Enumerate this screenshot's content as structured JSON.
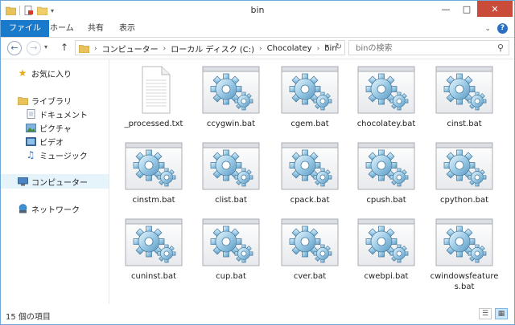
{
  "window": {
    "title": "bin"
  },
  "ribbon": {
    "tabs": [
      {
        "label": "ファイル"
      },
      {
        "label": "ホーム"
      },
      {
        "label": "共有"
      },
      {
        "label": "表示"
      }
    ]
  },
  "address": {
    "crumbs": [
      "コンピューター",
      "ローカル ディスク (C:)",
      "Chocolatey",
      "bin"
    ]
  },
  "search": {
    "placeholder": "binの検索"
  },
  "navpane": {
    "favorites": "お気に入り",
    "libraries": "ライブラリ",
    "documents": "ドキュメント",
    "pictures": "ピクチャ",
    "videos": "ビデオ",
    "music": "ミュージック",
    "computer": "コンピューター",
    "network": "ネットワーク"
  },
  "files": [
    {
      "name": "_processed.txt",
      "icon": "text-file-icon"
    },
    {
      "name": "ccygwin.bat",
      "icon": "batch-file-icon"
    },
    {
      "name": "cgem.bat",
      "icon": "batch-file-icon"
    },
    {
      "name": "chocolatey.bat",
      "icon": "batch-file-icon"
    },
    {
      "name": "cinst.bat",
      "icon": "batch-file-icon"
    },
    {
      "name": "cinstm.bat",
      "icon": "batch-file-icon"
    },
    {
      "name": "clist.bat",
      "icon": "batch-file-icon"
    },
    {
      "name": "cpack.bat",
      "icon": "batch-file-icon"
    },
    {
      "name": "cpush.bat",
      "icon": "batch-file-icon"
    },
    {
      "name": "cpython.bat",
      "icon": "batch-file-icon"
    },
    {
      "name": "cuninst.bat",
      "icon": "batch-file-icon"
    },
    {
      "name": "cup.bat",
      "icon": "batch-file-icon"
    },
    {
      "name": "cver.bat",
      "icon": "batch-file-icon"
    },
    {
      "name": "cwebpi.bat",
      "icon": "batch-file-icon"
    },
    {
      "name": "cwindowsfeatures.bat",
      "icon": "batch-file-icon"
    }
  ],
  "status": {
    "count": "15 個の項目"
  },
  "colors": {
    "accent": "#1979ca",
    "close": "#c94b3a"
  }
}
